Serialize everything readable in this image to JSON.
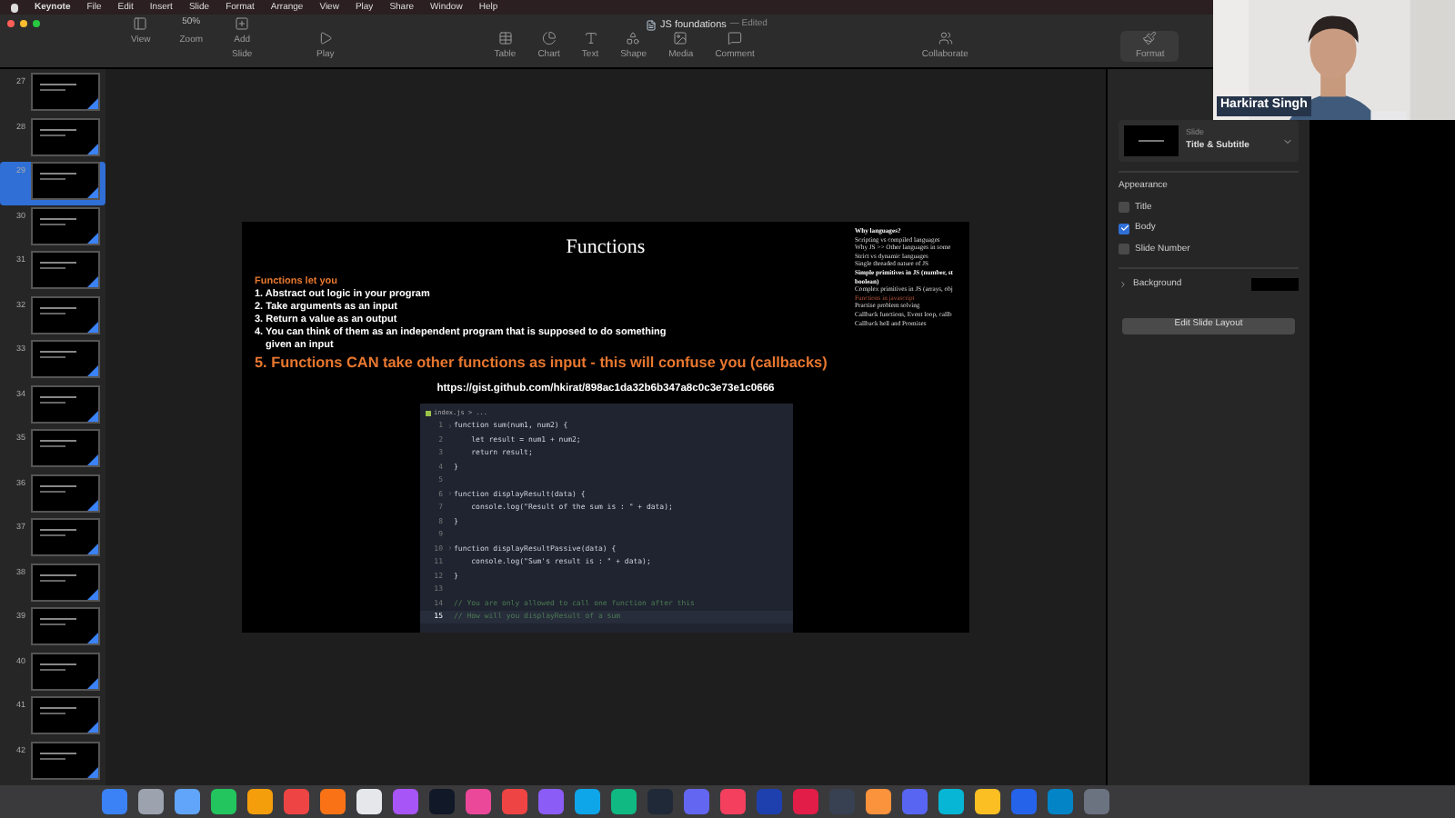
{
  "menu_bar": {
    "items": [
      "Keynote",
      "File",
      "Edit",
      "Insert",
      "Slide",
      "Format",
      "Arrange",
      "View",
      "Play",
      "Share",
      "Window",
      "Help"
    ]
  },
  "window": {
    "title": "JS foundations",
    "status": "— Edited"
  },
  "toolbar": {
    "left": [
      {
        "label": "View"
      },
      {
        "label": "Zoom",
        "value": "50%"
      },
      {
        "label": "Add Slide"
      }
    ],
    "center": [
      {
        "label": "Play"
      }
    ],
    "insert": [
      {
        "label": "Table"
      },
      {
        "label": "Chart"
      },
      {
        "label": "Text"
      },
      {
        "label": "Shape"
      },
      {
        "label": "Media"
      },
      {
        "label": "Comment"
      }
    ],
    "right": [
      {
        "label": "Collaborate",
        "selected": false
      },
      {
        "label": "Format",
        "selected": true
      }
    ]
  },
  "slide_navigator": {
    "slides": [
      {
        "number": "27",
        "selected": false
      },
      {
        "number": "28",
        "selected": false
      },
      {
        "number": "29",
        "selected": true
      },
      {
        "number": "30",
        "selected": false
      },
      {
        "number": "31",
        "selected": false
      },
      {
        "number": "32",
        "selected": false
      },
      {
        "number": "33",
        "selected": false
      },
      {
        "number": "34",
        "selected": false
      },
      {
        "number": "35",
        "selected": false
      },
      {
        "number": "36",
        "selected": false
      },
      {
        "number": "37",
        "selected": false
      },
      {
        "number": "38",
        "selected": false
      },
      {
        "number": "39",
        "selected": false
      },
      {
        "number": "40",
        "selected": false
      },
      {
        "number": "41",
        "selected": false
      },
      {
        "number": "42",
        "selected": false
      }
    ]
  },
  "slide": {
    "title": "Functions",
    "intro": "Functions let you",
    "points": [
      "1. Abstract out logic in your program",
      "2. Take arguments as an input",
      "3. Return a value as an output",
      "4. You can think of them as an independent program that is supposed to do something",
      "given an input"
    ],
    "highlight": "5. Functions CAN take other functions as input - this will confuse you (callbacks)",
    "link": "https://gist.github.com/hkirat/898ac1da32b6b347a8c0c3e73e1c0666",
    "code": {
      "filename": "index.js",
      "path": "> ...",
      "lines": [
        {
          "number": "1",
          "text": "function sum(num1, num2) {",
          "kind": "code",
          "foldable": true,
          "selected": false
        },
        {
          "number": "2",
          "text": "    let result = num1 + num2;",
          "kind": "code",
          "foldable": false,
          "selected": false
        },
        {
          "number": "3",
          "text": "    return result;",
          "kind": "code",
          "foldable": false,
          "selected": false
        },
        {
          "number": "4",
          "text": "}",
          "kind": "code",
          "foldable": false,
          "selected": false
        },
        {
          "number": "5",
          "kind": "blank",
          "foldable": false,
          "selected": false
        },
        {
          "number": "6",
          "text": "function displayResult(data) {",
          "kind": "code",
          "foldable": true,
          "selected": false
        },
        {
          "number": "7",
          "text": "    console.log(\"Result of the sum is : \" + data);",
          "kind": "code",
          "foldable": false,
          "selected": false
        },
        {
          "number": "8",
          "text": "}",
          "kind": "code",
          "foldable": false,
          "selected": false
        },
        {
          "number": "9",
          "kind": "blank",
          "foldable": false,
          "selected": false
        },
        {
          "number": "10",
          "text": "function displayResultPassive(data) {",
          "kind": "code",
          "foldable": true,
          "selected": false
        },
        {
          "number": "11",
          "text": "    console.log(\"Sum's result is : \" + data);",
          "kind": "code",
          "foldable": false,
          "selected": false
        },
        {
          "number": "12",
          "text": "}",
          "kind": "code",
          "foldable": false,
          "selected": false
        },
        {
          "number": "13",
          "kind": "blank",
          "foldable": false,
          "selected": false
        },
        {
          "number": "14",
          "text": "// You are only allowed to call one function after this",
          "kind": "comment",
          "foldable": false,
          "selected": false
        },
        {
          "number": "15",
          "text": "// How will you displayResult of a sum",
          "kind": "comment",
          "foldable": false,
          "selected": true
        }
      ]
    },
    "outline": [
      {
        "text": "Why languages?",
        "kind": "heading"
      },
      {
        "text": "Scripting vs compiled languages",
        "kind": "item"
      },
      {
        "text": "Why JS >> Other languages in some",
        "kind": "item"
      },
      {
        "text": "Strict vs dynamic languages",
        "kind": "item"
      },
      {
        "text": "Single threaded nature of JS",
        "kind": "item"
      },
      {
        "text": "Simple primitives in JS (number, st",
        "kind": "heading"
      },
      {
        "text": "boolean)",
        "kind": "heading"
      },
      {
        "text": "Complex primitives in JS (arrays, obj",
        "kind": "item"
      },
      {
        "text": "Functions in javascript",
        "kind": "current"
      },
      {
        "text": "Practise problem solving",
        "kind": "item"
      },
      {
        "text": "Callback functions, Event loop, callb",
        "kind": "item"
      },
      {
        "text": "Callback hell and Promises",
        "kind": "item"
      }
    ]
  },
  "inspector": {
    "layout_label": "Slide",
    "layout_name": "Title & Subtitle",
    "appearance_label": "Appearance",
    "options": [
      {
        "label": "Title",
        "checked": false
      },
      {
        "label": "Body",
        "checked": true
      },
      {
        "label": "Slide Number",
        "checked": false
      }
    ],
    "background_label": "Background",
    "edit_button": "Edit Slide Layout"
  },
  "video": {
    "name": "Harkirat Singh"
  }
}
